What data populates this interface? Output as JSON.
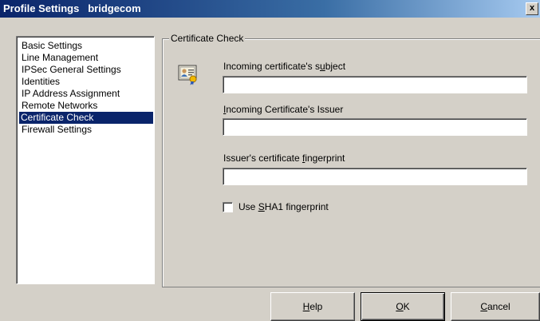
{
  "window": {
    "title": "Profile Settings",
    "profile_name": "bridgecom",
    "close_glyph": "x"
  },
  "sidebar": {
    "items": [
      {
        "label": "Basic Settings",
        "selected": false
      },
      {
        "label": "Line Management",
        "selected": false
      },
      {
        "label": "IPSec General Settings",
        "selected": false
      },
      {
        "label": "Identities",
        "selected": false
      },
      {
        "label": "IP Address Assignment",
        "selected": false
      },
      {
        "label": "Remote Networks",
        "selected": false
      },
      {
        "label": "Certificate Check",
        "selected": true
      },
      {
        "label": "Firewall Settings",
        "selected": false
      }
    ]
  },
  "panel": {
    "group_title": "Certificate Check",
    "icon": "certificate-icon",
    "fields": [
      {
        "label_pre": "Incoming certificate's s",
        "label_key": "u",
        "label_post": "bject",
        "value": ""
      },
      {
        "label_pre": "",
        "label_key": "I",
        "label_post": "ncoming Certificate's Issuer",
        "value": ""
      },
      {
        "label_pre": "Issuer's certificate ",
        "label_key": "f",
        "label_post": "ingerprint",
        "value": ""
      }
    ],
    "sha1_checkbox": {
      "label_pre": "Use ",
      "label_key": "S",
      "label_post": "HA1 fingerprint",
      "checked": false
    }
  },
  "buttons": {
    "help": {
      "pre": "",
      "key": "H",
      "post": "elp"
    },
    "ok": {
      "pre": "",
      "key": "O",
      "post": "K"
    },
    "cancel": {
      "pre": "",
      "key": "C",
      "post": "ancel"
    }
  }
}
